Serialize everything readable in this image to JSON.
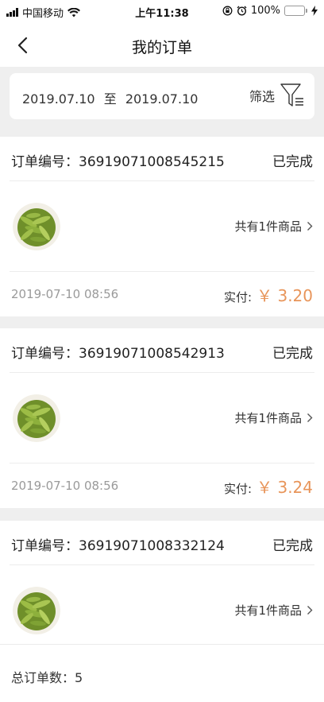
{
  "status_bar": {
    "carrier": "中国移动",
    "time": "上午11:38",
    "battery": "100%",
    "icons": [
      "signal-icon",
      "wifi-icon",
      "rotation-lock-icon",
      "alarm-icon",
      "battery-icon",
      "charging-icon"
    ]
  },
  "nav": {
    "title": "我的订单",
    "back_icon": "chevron-left-icon"
  },
  "filter": {
    "start_date": "2019.07.10",
    "separator": "至",
    "end_date": "2019.07.10",
    "filter_label": "筛选",
    "filter_icon": "funnel-icon"
  },
  "orders": [
    {
      "no_label": "订单编号：",
      "no": "36919071008545215",
      "status": "已完成",
      "goods_count": "共有1件商品",
      "time": "2019-07-10 08:56",
      "paid_label": "实付:",
      "paid_amount": "￥ 3.20"
    },
    {
      "no_label": "订单编号：",
      "no": "36919071008542913",
      "status": "已完成",
      "goods_count": "共有1件商品",
      "time": "2019-07-10 08:56",
      "paid_label": "实付:",
      "paid_amount": "￥ 3.24"
    },
    {
      "no_label": "订单编号：",
      "no": "36919071008332124",
      "status": "已完成",
      "goods_count": "共有1件商品"
    }
  ],
  "footer": {
    "total_label": "总订单数：",
    "total_count": "5"
  },
  "colors": {
    "accent_price": "#e8955a",
    "background": "#efefef",
    "card": "#ffffff",
    "battery": "#4cd964"
  }
}
